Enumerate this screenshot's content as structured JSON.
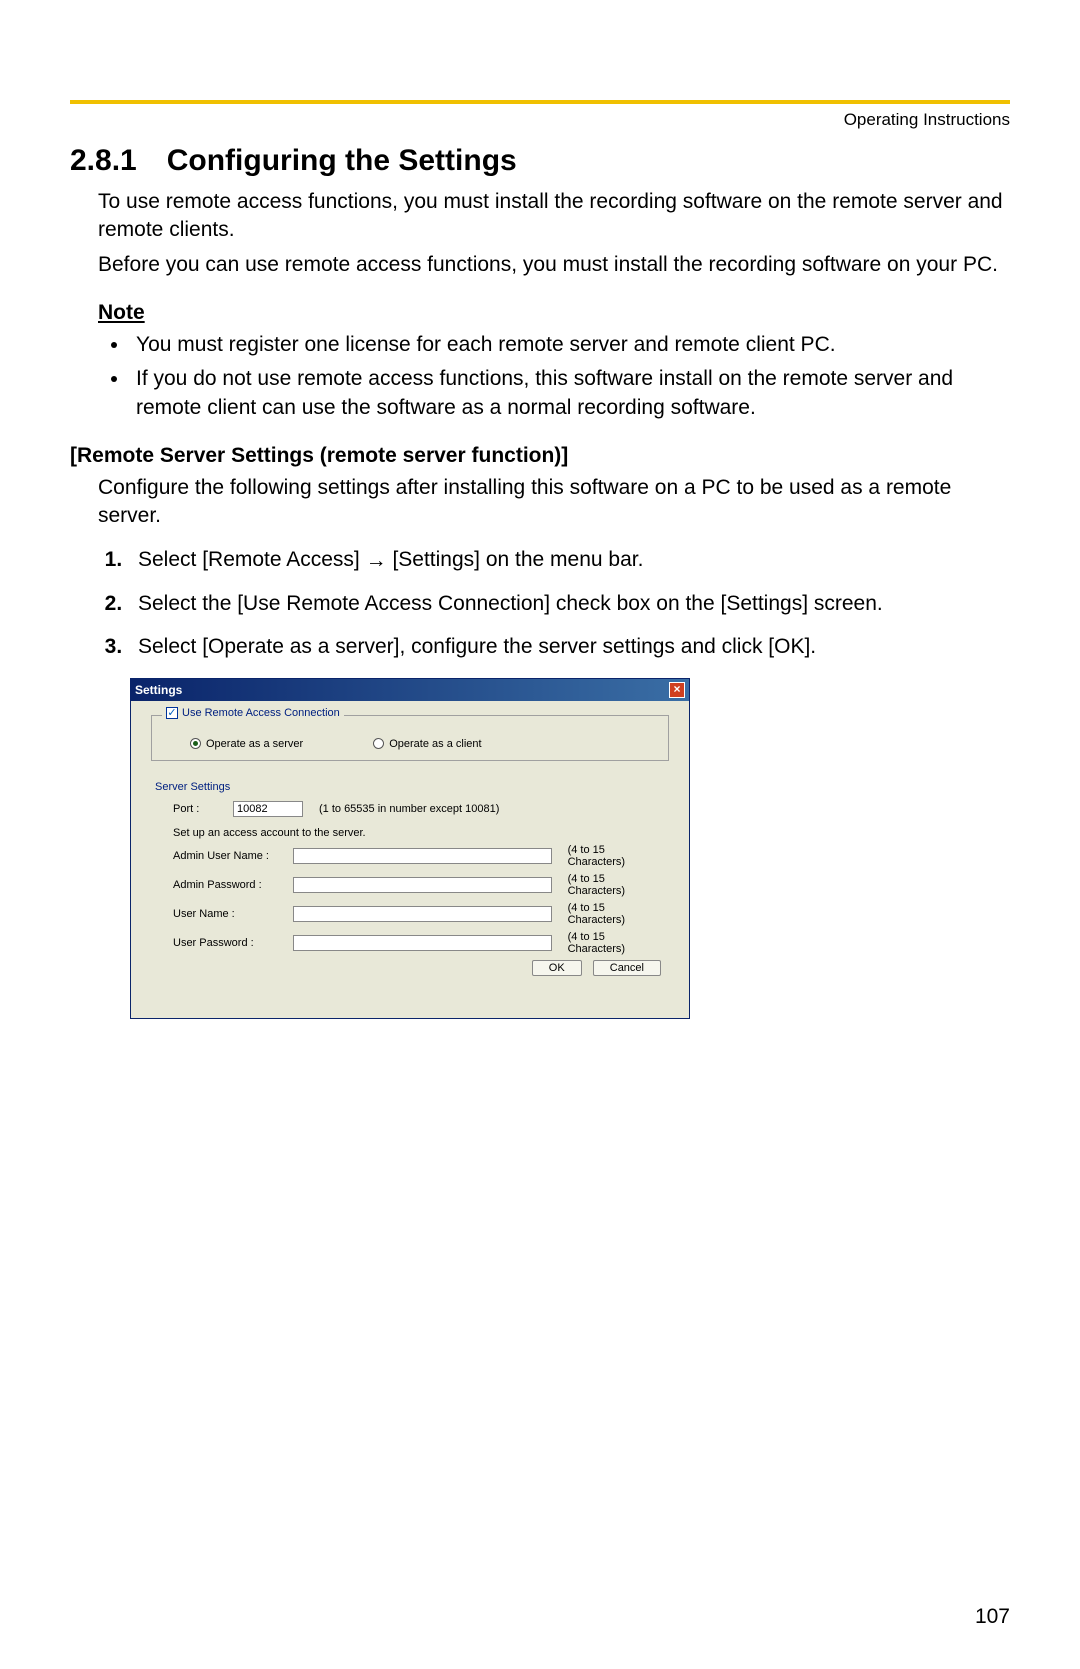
{
  "header": {
    "doc_label": "Operating Instructions"
  },
  "section": {
    "number": "2.8.1",
    "title": "Configuring the Settings",
    "intro1": "To use remote access functions, you must install the recording software on the remote server and remote clients.",
    "intro2": "Before you can use remote access functions, you must install the recording software on your PC."
  },
  "note": {
    "heading": "Note",
    "items": [
      "You must register one license for each remote server and remote client PC.",
      "If you do not use remote access functions, this software install on the remote server and remote client can use the software as a normal recording software."
    ]
  },
  "remote": {
    "heading": "[Remote Server Settings (remote server function)]",
    "intro": "Configure the following settings after installing this software on a PC to be used as a remote server.",
    "steps": {
      "s1a": "Select [Remote Access] ",
      "s1b": " [Settings] on the menu bar.",
      "s2": "Select the [Use Remote Access Connection] check box on the [Settings] screen.",
      "s3": "Select [Operate as a server], configure the server settings and click [OK]."
    }
  },
  "dialog": {
    "title": "Settings",
    "use_remote_label": "Use Remote Access Connection",
    "operate_server": "Operate as a server",
    "operate_client": "Operate as a client",
    "server_settings_label": "Server Settings",
    "port_label": "Port   :",
    "port_value": "10082",
    "port_hint": "(1 to 65535 in number except 10081)",
    "setup_text": "Set up an access account to the server.",
    "admin_user_label": "Admin User Name :",
    "admin_pass_label": "Admin Password   :",
    "user_label": "User Name          :",
    "user_pass_label": "User Password    :",
    "char_hint": "(4 to 15 Characters)",
    "ok": "OK",
    "cancel": "Cancel"
  },
  "page_number": "107"
}
